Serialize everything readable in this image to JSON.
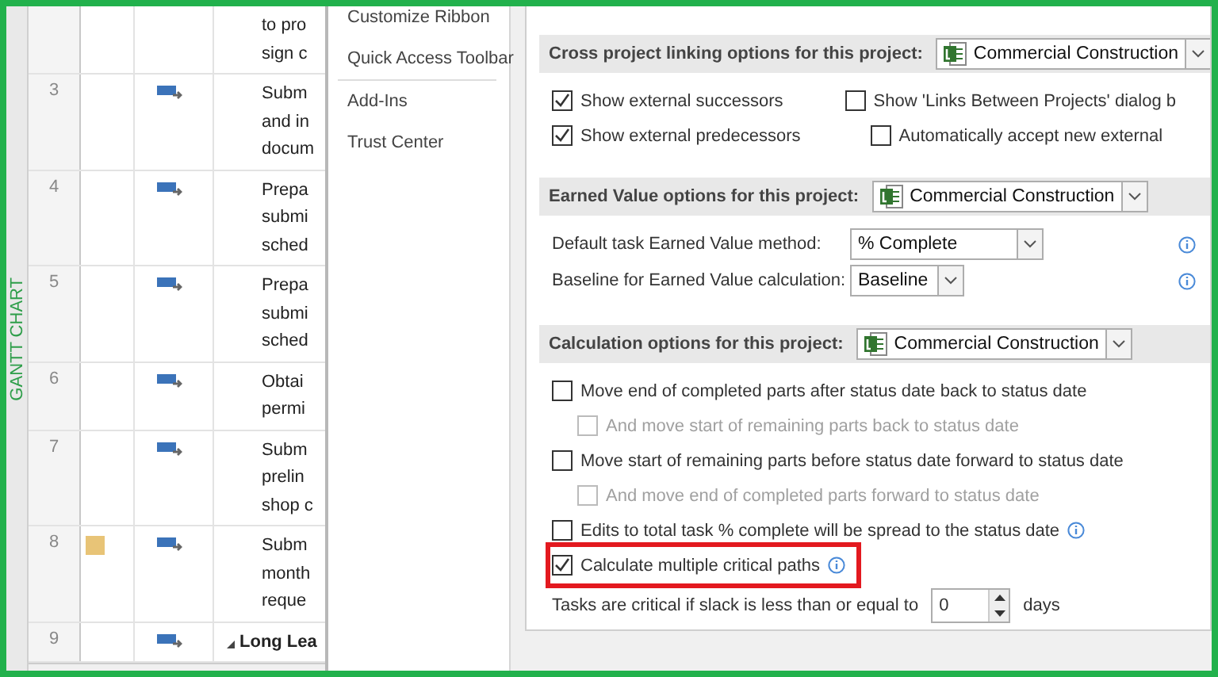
{
  "gantt": {
    "side_label": "GANTT CHART",
    "rows": [
      {
        "name_lines": [
          "to pro",
          "sign c"
        ],
        "has_note": false,
        "summary": false
      },
      {
        "number": "3",
        "name_lines": [
          "Subm",
          "and in",
          "docum"
        ],
        "has_note": false,
        "summary": false
      },
      {
        "number": "4",
        "name_lines": [
          "Prepa",
          "submi",
          "sched"
        ],
        "has_note": false,
        "summary": false
      },
      {
        "number": "5",
        "name_lines": [
          "Prepa",
          "submi",
          "sched"
        ],
        "has_note": false,
        "summary": false
      },
      {
        "number": "6",
        "name_lines": [
          "Obtai",
          "permi"
        ],
        "has_note": false,
        "summary": false
      },
      {
        "number": "7",
        "name_lines": [
          "Subm",
          "prelin",
          "shop c"
        ],
        "has_note": false,
        "summary": false
      },
      {
        "number": "8",
        "name_lines": [
          "Subm",
          "month",
          "reque"
        ],
        "has_note": true,
        "summary": false
      },
      {
        "number": "9",
        "name_lines": [
          "Long Lea"
        ],
        "has_note": false,
        "summary": true
      }
    ]
  },
  "dialog": {
    "nav": [
      {
        "label": "Customize Ribbon",
        "selected": false
      },
      {
        "label": "Quick Access Toolbar",
        "selected": false
      },
      {
        "label": "Add-Ins",
        "selected": false
      },
      {
        "label": "Trust Center",
        "selected": false
      }
    ],
    "sections": [
      {
        "title": "Cross project linking options for this project:",
        "project": "Commercial Construction",
        "items": [
          {
            "kind": "columns",
            "columns": [
              [
                {
                  "label": "Show external successors",
                  "checked": true,
                  "disabled": false
                },
                {
                  "label": "Show external predecessors",
                  "checked": true,
                  "disabled": false
                }
              ],
              [
                {
                  "label": "Show 'Links Between Projects' dialog b",
                  "checked": false,
                  "disabled": false,
                  "children": [
                    {
                      "label": "Automatically accept new external",
                      "checked": false,
                      "disabled": false
                    }
                  ]
                }
              ]
            ]
          }
        ]
      },
      {
        "title": "Earned Value options for this project:",
        "project": "Commercial Construction",
        "items": [
          {
            "kind": "select",
            "label": "Default task Earned Value method:",
            "value": "% Complete",
            "wide": true,
            "info": true
          },
          {
            "kind": "select",
            "label": "Baseline for Earned Value calculation:",
            "value": "Baseline",
            "wide": false,
            "info": true
          }
        ]
      },
      {
        "title": "Calculation options for this project:",
        "project": "Commercial Construction",
        "items": [
          {
            "kind": "check",
            "label": "Move end of completed parts after status date back to status date",
            "checked": false,
            "disabled": false,
            "info": false,
            "highlighted": false,
            "children": [
              {
                "label": "And move start of remaining parts back to status date",
                "checked": false,
                "disabled": true
              }
            ]
          },
          {
            "kind": "check",
            "label": "Move start of remaining parts before status date forward to status date",
            "checked": false,
            "disabled": false,
            "info": false,
            "highlighted": false,
            "children": [
              {
                "label": "And move end of completed parts forward to status date",
                "checked": false,
                "disabled": true
              }
            ]
          },
          {
            "kind": "check",
            "label": "Edits to total task % complete will be spread to the status date",
            "checked": false,
            "disabled": false,
            "info": true,
            "highlighted": false
          },
          {
            "kind": "check",
            "label": "Calculate multiple critical paths",
            "checked": true,
            "disabled": false,
            "info": true,
            "highlighted": true
          },
          {
            "kind": "spin",
            "label": "Tasks are critical if slack is less than or equal to",
            "value": "0",
            "unit": "days"
          }
        ]
      }
    ]
  }
}
